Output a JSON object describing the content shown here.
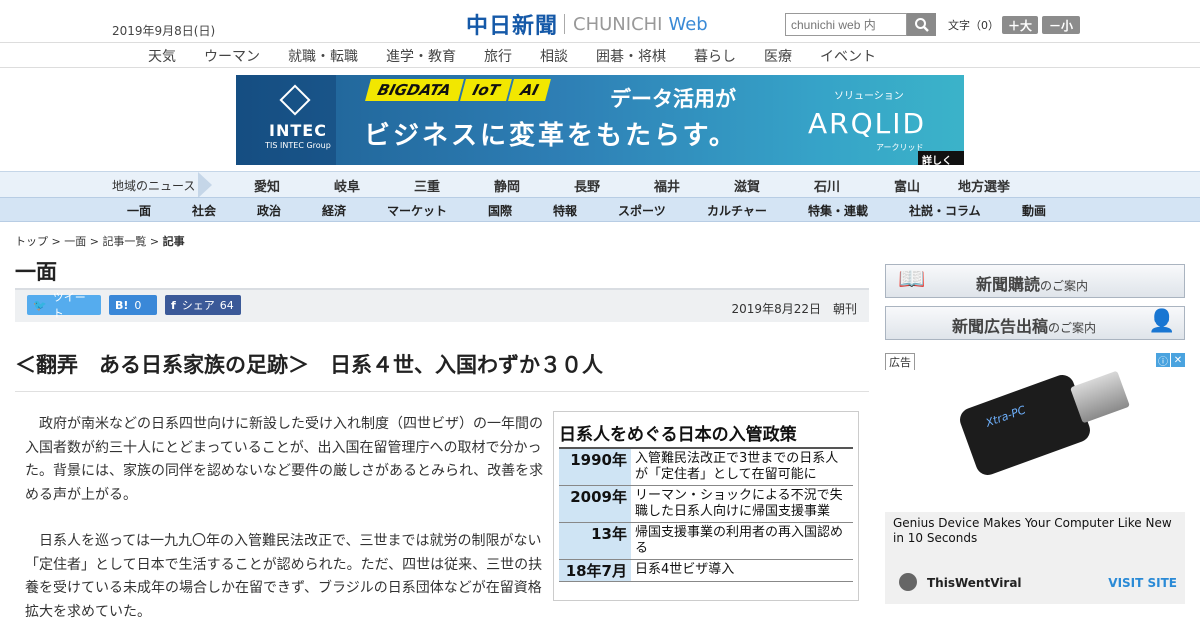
{
  "header": {
    "date": "2019年9月8日(日)",
    "logo_jp": "中日新聞",
    "logo_en": "CHUNICHI",
    "logo_web": "Web",
    "search_placeholder": "chunichi web 内",
    "fontsize_label": "文字（0）",
    "font_large": "＋大",
    "font_small": "－小"
  },
  "category_nav": [
    "天気",
    "ウーマン",
    "就職・転職",
    "進学・教育",
    "旅行",
    "相談",
    "囲碁・将棋",
    "暮らし",
    "医療",
    "イベント"
  ],
  "banner": {
    "tags": [
      "BIGDATA",
      "IoT",
      "AI"
    ],
    "headline1": "データ活用が",
    "headline2": "ビジネスに変革をもたらす。",
    "intec_name": "INTEC",
    "intec_sub": "TIS INTEC Group",
    "solution_label": "ソリューション",
    "product": "ARQLID",
    "product_kana": "アークリッド",
    "details": "詳しくは"
  },
  "region_nav": {
    "label": "地域のニュース",
    "items": [
      "愛知",
      "岐阜",
      "三重",
      "静岡",
      "長野",
      "福井",
      "滋賀",
      "石川",
      "富山",
      "地方選挙"
    ]
  },
  "section_nav": [
    "一面",
    "社会",
    "政治",
    "経済",
    "マーケット",
    "国際",
    "特報",
    "スポーツ",
    "カルチャー",
    "特集・連載",
    "社説・コラム",
    "動画"
  ],
  "breadcrumb": {
    "top": "トップ",
    "front": "一面",
    "list": "記事一覧",
    "current": "記事",
    "sep": " > "
  },
  "page_title": "一面",
  "share": {
    "tweet": "ツイート",
    "hatena_count": "0",
    "facebook": "シェア",
    "facebook_count": "64",
    "date": "2019年8月22日",
    "edition": "朝刊"
  },
  "article": {
    "headline": "＜翻弄　ある日系家族の足跡＞　日系４世、入国わずか３０人",
    "paragraphs": [
      "政府が南米などの日系四世向けに新設した受け入れ制度（四世ビザ）の一年間の入国者数が約三十人にとどまっていることが、出入国在留管理庁への取材で分かった。背景には、家族の同伴を認めないなど要件の厳しさがあるとみられ、改善を求める声が上がる。",
      "日系人を巡っては一九九〇年の入管難民法改正で、三世までは就労の制限がない「定住者」として日本で生活することが認められた。ただ、四世は従来、三世の扶養を受けている未成年の場合しか在留できず、ブラジルの日系団体などが在留資格拡大を求めていた。"
    ]
  },
  "policy_table": {
    "title": "日系人をめぐる日本の入管政策",
    "rows": [
      {
        "year": "1990年",
        "text": "入管難民法改正で3世までの日系人が「定住者」として在留可能に"
      },
      {
        "year": "2009年",
        "text": "リーマン・ショックによる不況で失職した日系人向けに帰国支援事業"
      },
      {
        "year": "13年",
        "text": "帰国支援事業の利用者の再入国認める"
      },
      {
        "year": "18年7月",
        "text": "日系4世ビザ導入"
      }
    ]
  },
  "sidebar": {
    "subscribe_main": "新聞購読",
    "subscribe_sub": "のご案内",
    "ads_main": "新聞広告出稿",
    "ads_sub": "のご案内",
    "ad_label": "広告",
    "usb_brand": "Xtra-PC",
    "ad_headline": "Genius Device Makes Your Computer Like New in 10 Seconds",
    "ad_brand": "ThisWentViral",
    "ad_visit": "VISIT SITE"
  }
}
